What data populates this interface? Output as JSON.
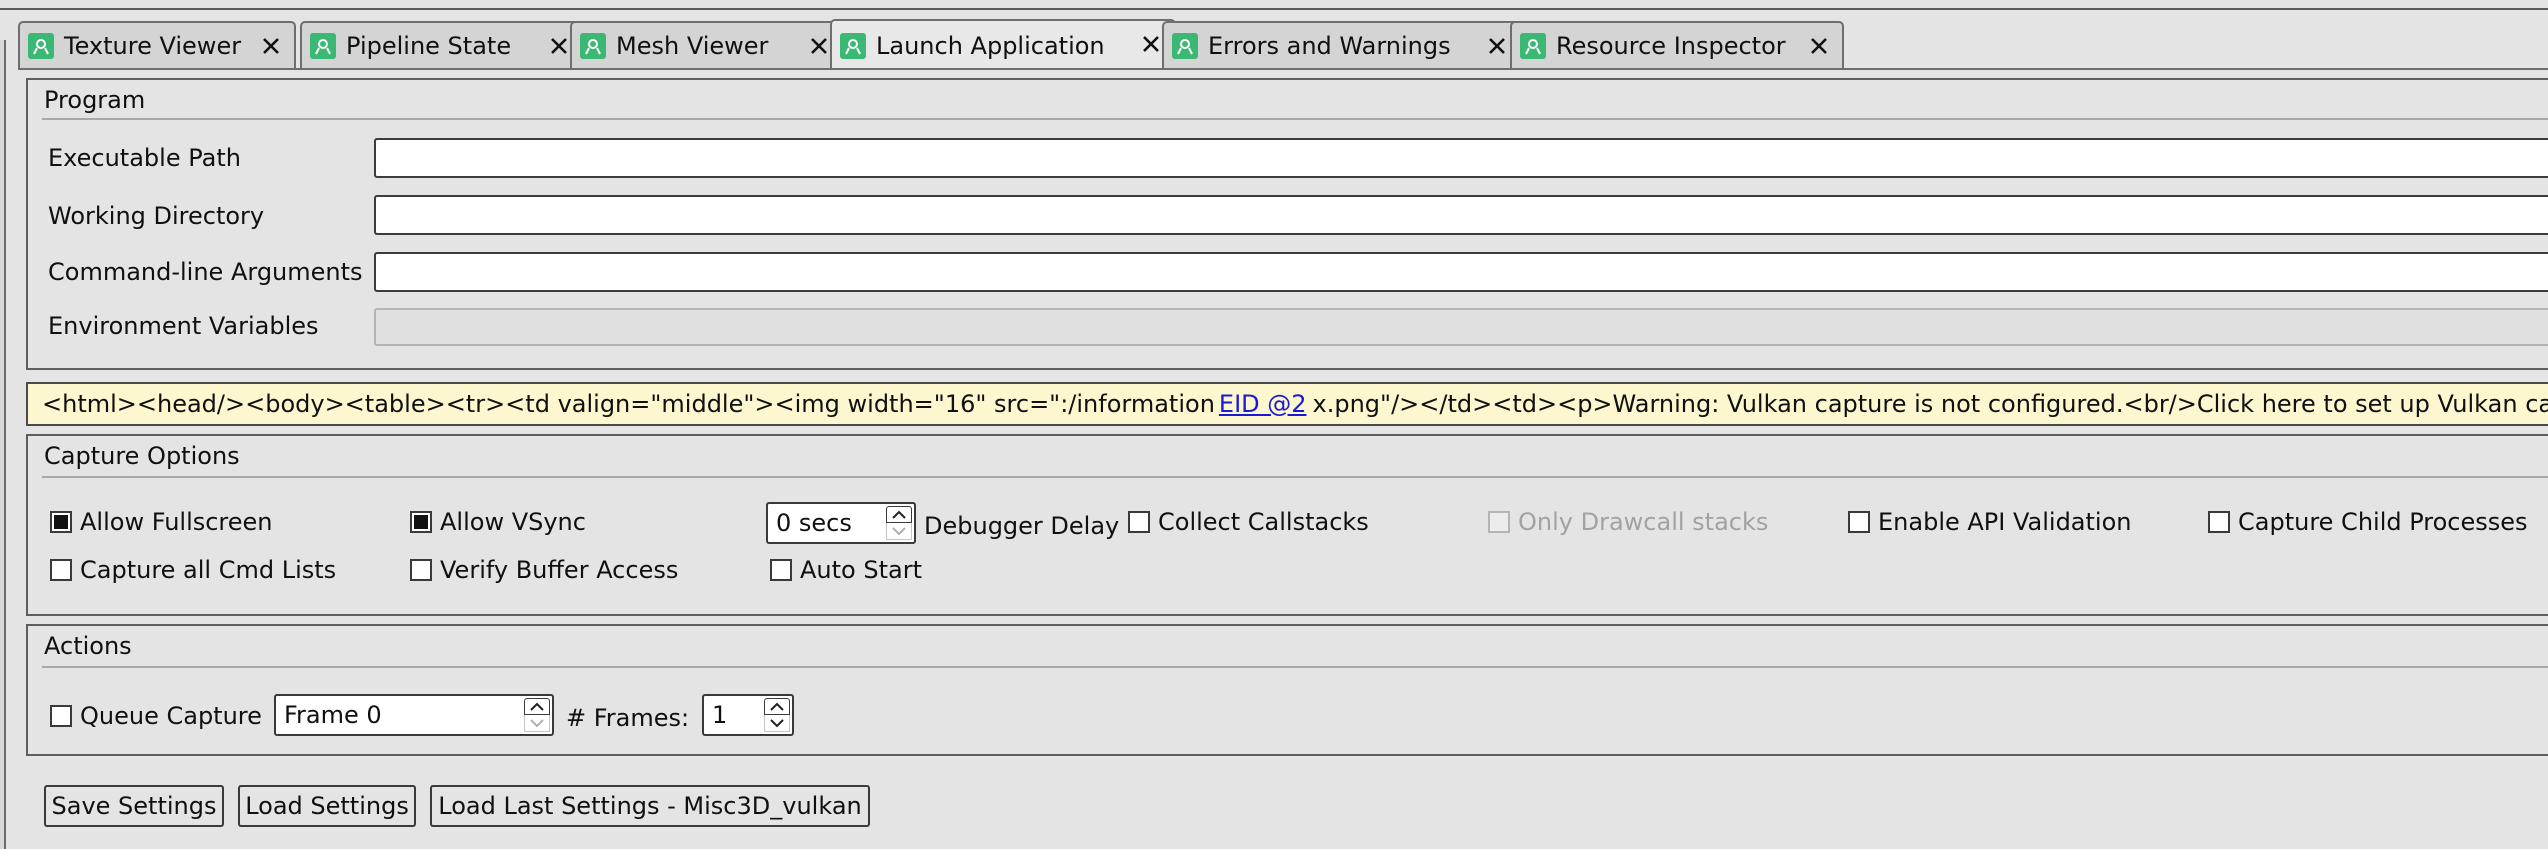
{
  "tabs": [
    {
      "label": "Texture Viewer",
      "icon": "app-icon",
      "active": false
    },
    {
      "label": "Pipeline State",
      "icon": "app-icon",
      "active": false
    },
    {
      "label": "Mesh Viewer",
      "icon": "app-icon",
      "active": false
    },
    {
      "label": "Launch Application",
      "icon": "app-icon",
      "active": true
    },
    {
      "label": "Errors and Warnings",
      "icon": "app-icon",
      "active": false
    },
    {
      "label": "Resource Inspector",
      "icon": "app-icon",
      "active": false
    }
  ],
  "program": {
    "title": "Program",
    "executable_path_label": "Executable Path",
    "executable_path_value": "",
    "working_directory_label": "Working Directory",
    "working_directory_value": "",
    "cmdline_label": "Command-line Arguments",
    "cmdline_value": "",
    "env_label": "Environment Variables",
    "env_value": ""
  },
  "warning": {
    "text_before": "<html><head/><body><table><tr><td valign=\"middle\"><img width=\"16\" src=\":/information",
    "link": "EID @2",
    "text_after": "x.png\"/></td><td><p>Warning: Vulkan capture is not configured.<br/>Click here to set up Vulkan capture.</p></td></tr></table></body></html>"
  },
  "capture_options": {
    "title": "Capture Options",
    "allow_fullscreen": "Allow Fullscreen",
    "allow_vsync": "Allow VSync",
    "debugger_delay_value": "0 secs",
    "debugger_delay_label": "Debugger Delay",
    "collect_callstacks": "Collect Callstacks",
    "only_drawcall_stacks": "Only Drawcall stacks",
    "enable_api_validation": "Enable API Validation",
    "capture_child_processes": "Capture Child Processes",
    "capture_all_cmd_lists": "Capture all Cmd Lists",
    "verify_buffer_access": "Verify Buffer Access",
    "auto_start": "Auto Start"
  },
  "actions": {
    "title": "Actions",
    "queue_capture": "Queue Capture",
    "frame_value": "Frame 0",
    "frames_label": "# Frames:",
    "frames_value": "1"
  },
  "buttons": {
    "save_settings": "Save Settings",
    "load_settings": "Load Settings",
    "load_last_settings": "Load Last Settings - Misc3D_vulkan"
  },
  "colors": {
    "tab_icon": "#3bb873",
    "warning_bg": "#fcf7cf",
    "link": "#1a1ad6"
  }
}
